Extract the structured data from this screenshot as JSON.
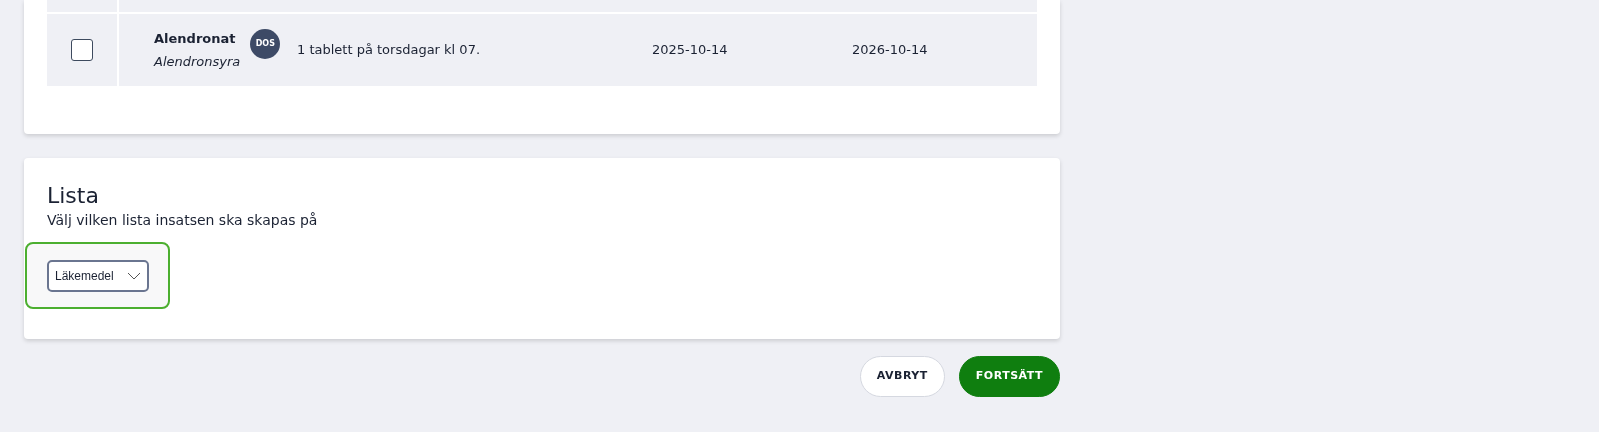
{
  "medications": {
    "rows": [
      {
        "checked": false,
        "name": "Alendronat",
        "substance": "Alendronsyra",
        "badge": "DOS",
        "dosage": "1 tablett på torsdagar kl 07.",
        "start_date": "2025-10-14",
        "end_date": "2026-10-14"
      }
    ]
  },
  "list_section": {
    "title": "Lista",
    "subtitle": "Välj vilken lista insatsen ska skapas på",
    "select": {
      "value": "Läkemedel",
      "highlighted": true
    }
  },
  "buttons": [
    {
      "kind": "secondary",
      "label": "AVBRYT"
    },
    {
      "kind": "primary",
      "label": "FORTSÄTT"
    }
  ]
}
